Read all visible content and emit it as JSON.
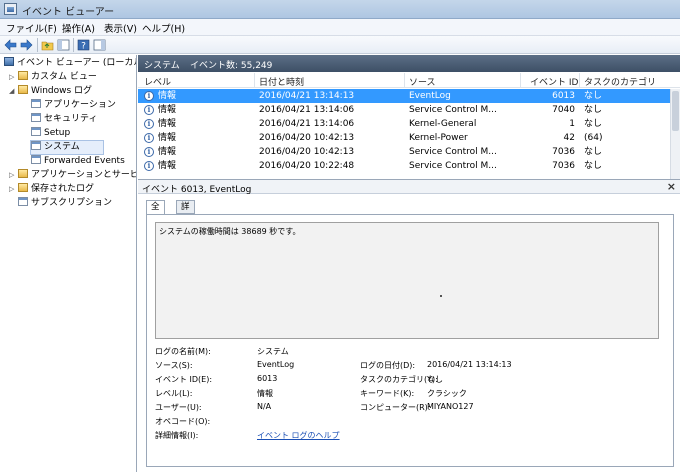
{
  "window": {
    "title": "イベント ビューアー"
  },
  "menu": [
    "ファイル(F)",
    "操作(A)",
    "表示(V)",
    "ヘルプ(H)"
  ],
  "tree": {
    "root": "イベント ビューアー (ローカル)",
    "custom_views": "カスタム ビュー",
    "windows_logs": "Windows ログ",
    "logs": [
      "アプリケーション",
      "セキュリティ",
      "Setup",
      "システム",
      "Forwarded Events"
    ],
    "apps_services": "アプリケーションとサービス ログ",
    "saved_logs": "保存されたログ",
    "subscriptions": "サブスクリプション"
  },
  "list": {
    "log_name": "システム",
    "event_count": "イベント数: 55,249",
    "columns": [
      "レベル",
      "日付と時刻",
      "ソース",
      "イベント ID",
      "タスクのカテゴリ"
    ],
    "rows": [
      {
        "level": "情報",
        "date": "2016/04/21 13:14:13",
        "source": "EventLog",
        "id": "6013",
        "task": "なし"
      },
      {
        "level": "情報",
        "date": "2016/04/21 13:14:06",
        "source": "Service Control M...",
        "id": "7040",
        "task": "なし"
      },
      {
        "level": "情報",
        "date": "2016/04/21 13:14:06",
        "source": "Kernel-General",
        "id": "1",
        "task": "なし"
      },
      {
        "level": "情報",
        "date": "2016/04/20 10:42:13",
        "source": "Kernel-Power",
        "id": "42",
        "task": "(64)"
      },
      {
        "level": "情報",
        "date": "2016/04/20 10:42:13",
        "source": "Service Control M...",
        "id": "7036",
        "task": "なし"
      },
      {
        "level": "情報",
        "date": "2016/04/20 10:22:48",
        "source": "Service Control M...",
        "id": "7036",
        "task": "なし"
      }
    ]
  },
  "detail": {
    "title": "イベント 6013, EventLog",
    "tabs": [
      "全般",
      "詳細"
    ],
    "description": "システムの稼働時間は 38689 秒です。",
    "fields": {
      "log_name_label": "ログの名前(M):",
      "log_name_value": "システム",
      "source_label": "ソース(S):",
      "source_value": "EventLog",
      "logged_label": "ログの日付(D):",
      "logged_value": "2016/04/21 13:14:13",
      "event_id_label": "イベント ID(E):",
      "event_id_value": "6013",
      "task_label": "タスクのカテゴリ(Y):",
      "task_value": "なし",
      "level_label": "レベル(L):",
      "level_value": "情報",
      "keywords_label": "キーワード(K):",
      "keywords_value": "クラシック",
      "user_label": "ユーザー(U):",
      "user_value": "N/A",
      "computer_label": "コンピューター(R):",
      "computer_value": "MIYANO127",
      "opcode_label": "オペコード(O):",
      "more_info_label": "詳細情報(I):",
      "more_info_link": "イベント ログのヘルプ"
    }
  }
}
